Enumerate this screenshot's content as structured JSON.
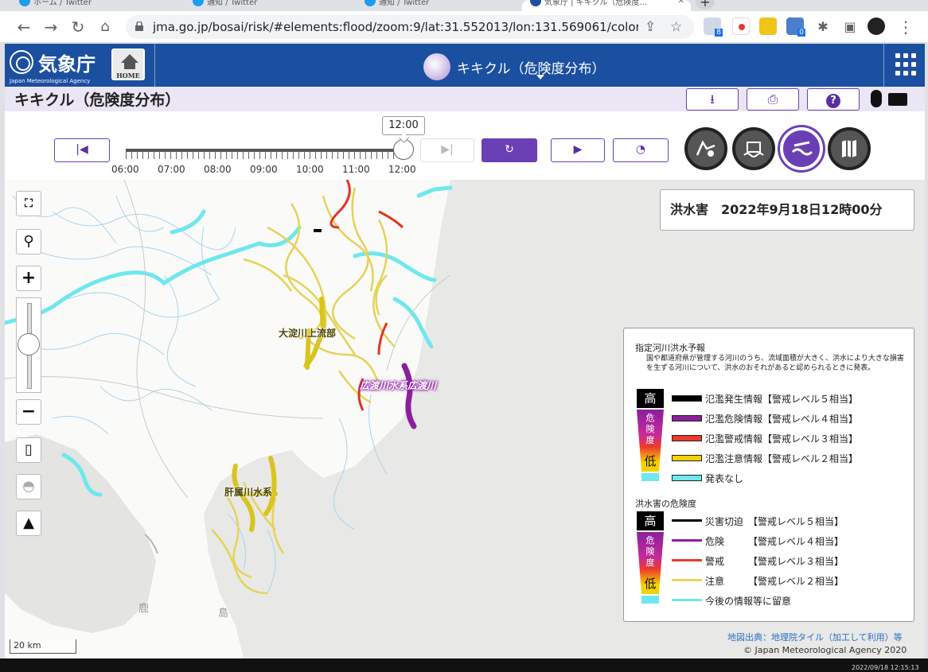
{
  "browser": {
    "tabs": [
      {
        "label": "ホーム / Twitter"
      },
      {
        "label": "通知 / Twitter"
      },
      {
        "label": "通知 / Twitter"
      },
      {
        "label": "気象庁 | キキクル（危険度…"
      }
    ],
    "url": "jma.go.jp/bosai/risk/#elements:flood/zoom:9/lat:31.552013/lon:131.569061/colordepth:n...",
    "ext_badges": [
      "8",
      "0"
    ]
  },
  "header": {
    "logo_kanji": "気象庁",
    "logo_english": "Japan Meteorological Agency",
    "home_label": "HOME",
    "center_title": "キキクル（危険度分布）"
  },
  "subheader": {
    "page_title": "キキクル（危険度分布）"
  },
  "timebar": {
    "current_time": "12:00",
    "ticks": [
      "06:00",
      "07:00",
      "08:00",
      "09:00",
      "10:00",
      "11:00",
      "12:00"
    ],
    "slider_position": 1.0
  },
  "map": {
    "timestamp": "洪水害　2022年9月18日12時00分",
    "river_labels": [
      "大淀川上流部",
      "広渡川水系広渡川",
      "肝属川水系"
    ],
    "place_labels": [
      "鹿",
      "島"
    ],
    "scale_label": "20 km",
    "credit": "地図出典：地理院タイル（加工して利用）等",
    "copyright": "© Japan Meteorological Agency 2020"
  },
  "legend": {
    "section1_title": "指定河川洪水予報",
    "section1_note": "国や都道府県が管理する河川のうち、流域面積が大きく、洪水により大きな損害を生ずる河川について、洪水のおそれがあると認められるときに発表。",
    "scale_high": "高",
    "scale_mid": "危険度",
    "scale_low": "低",
    "section1_rows": [
      {
        "label": "氾濫発生情報【警戒レベル５相当】",
        "color": "#000000"
      },
      {
        "label": "氾濫危険情報【警戒レベル４相当】",
        "color": "#8b1f9c"
      },
      {
        "label": "氾濫警戒情報【警戒レベル３相当】",
        "color": "#ee3a2e"
      },
      {
        "label": "氾濫注意情報【警戒レベル２相当】",
        "color": "#f5d100"
      },
      {
        "label": "発表なし",
        "color": "#6ee8ee"
      }
    ],
    "section2_title": "洪水害の危険度",
    "section2_rows": [
      {
        "label": "災害切迫　【警戒レベル５相当】",
        "color": "#000000"
      },
      {
        "label": "危険　　　【警戒レベル４相当】",
        "color": "#8b1f9c"
      },
      {
        "label": "警戒　　　【警戒レベル３相当】",
        "color": "#ee3a2e"
      },
      {
        "label": "注意　　　【警戒レベル２相当】",
        "color": "#e5d35a"
      },
      {
        "label": "今後の情報等に留意",
        "color": "#6ee8ee"
      }
    ]
  },
  "overlay": {
    "clock": "2022/09/18 12:15:13"
  }
}
